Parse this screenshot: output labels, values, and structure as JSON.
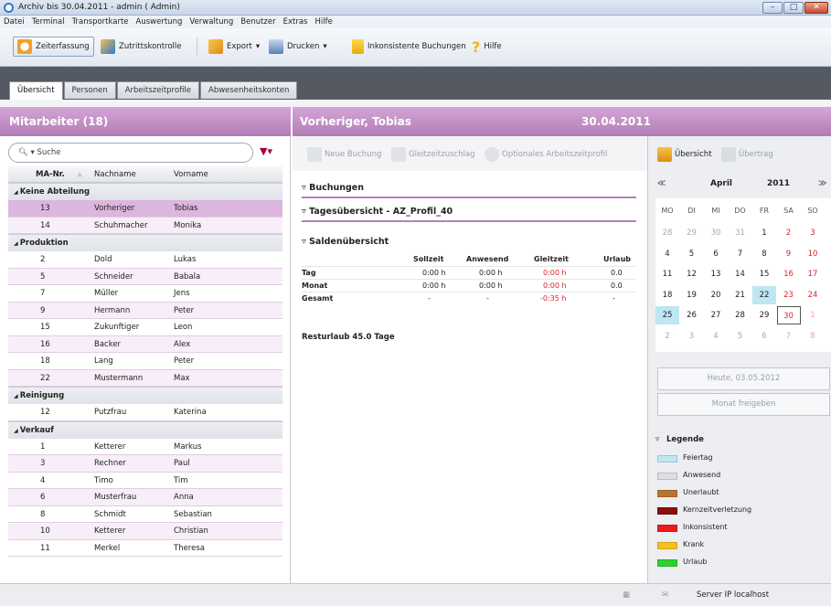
{
  "window": {
    "title": "Archiv bis 30.04.2011 - admin ( Admin)"
  },
  "menu": [
    "Datei",
    "Terminal",
    "Transportkarte",
    "Auswertung",
    "Verwaltung",
    "Benutzer",
    "Extras",
    "Hilfe"
  ],
  "toolbar": {
    "zeiterfassung": "Zeiterfassung",
    "zutrittskontrolle": "Zutrittskontrolle",
    "export": "Export",
    "drucken": "Drucken",
    "inkonsistente": "Inkonsistente Buchungen",
    "hilfe": "Hilfe"
  },
  "tabs": [
    "Übersicht",
    "Personen",
    "Arbeitszeitprofile",
    "Abwesenheitskonten"
  ],
  "left": {
    "header": "Mitarbeiter (18)",
    "search_placeholder": "Suche",
    "col_nr": "MA-Nr.",
    "col_nachname": "Nachname",
    "col_vorname": "Vorname",
    "groups": [
      {
        "name": "Keine Abteilung",
        "rows": [
          [
            "13",
            "Vorheriger",
            "Tobias"
          ],
          [
            "14",
            "Schuhmacher",
            "Monika"
          ]
        ]
      },
      {
        "name": "Produktion",
        "rows": [
          [
            "2",
            "Dold",
            "Lukas"
          ],
          [
            "5",
            "Schneider",
            "Babala"
          ],
          [
            "7",
            "Müller",
            "Jens"
          ],
          [
            "9",
            "Hermann",
            "Peter"
          ],
          [
            "15",
            "Zukunftiger",
            "Leon"
          ],
          [
            "16",
            "Backer",
            "Alex"
          ],
          [
            "18",
            "Lang",
            "Peter"
          ],
          [
            "22",
            "Mustermann",
            "Max"
          ]
        ]
      },
      {
        "name": "Reinigung",
        "rows": [
          [
            "12",
            "Putzfrau",
            "Katerina"
          ]
        ]
      },
      {
        "name": "Verkauf",
        "rows": [
          [
            "1",
            "Ketterer",
            "Markus"
          ],
          [
            "3",
            "Rechner",
            "Paul"
          ],
          [
            "4",
            "Timo",
            "Tim"
          ],
          [
            "6",
            "Musterfrau",
            "Anna"
          ],
          [
            "8",
            "Schmidt",
            "Sebastian"
          ],
          [
            "10",
            "Ketterer",
            "Christian"
          ],
          [
            "11",
            "Merkel",
            "Theresa"
          ]
        ]
      }
    ]
  },
  "center": {
    "header_name": "Vorheriger, Tobias",
    "header_date": "30.04.2011",
    "actions": [
      "Neue Buchung",
      "Gleitzeitzuschlag",
      "Optionales Arbeitszeitprofil"
    ],
    "sec_buchungen": "Buchungen",
    "sec_tages": "Tagesübersicht - AZ_Profil_40",
    "sec_salden": "Saldenübersicht",
    "saldo_cols": [
      "Sollzeit",
      "Anwesend",
      "Gleitzeit",
      "Urlaub"
    ],
    "saldo_rows": [
      {
        "label": "Tag",
        "values": [
          "0:00 h",
          "0:00 h",
          "0:00 h",
          "0.0"
        ]
      },
      {
        "label": "Monat",
        "values": [
          "0:00 h",
          "0:00 h",
          "0:00 h",
          "0.0"
        ]
      },
      {
        "label": "Gesamt",
        "values": [
          "-",
          "-",
          "-0:35 h",
          "-"
        ]
      }
    ],
    "resturlaub": "Resturlaub 45.0 Tage"
  },
  "right": {
    "uebersicht": "Übersicht",
    "uebertrag": "Übertrag",
    "month": "April",
    "year": "2011",
    "weekdays": [
      "MO",
      "DI",
      "MI",
      "DO",
      "FR",
      "SA",
      "SO"
    ],
    "days": [
      [
        "28",
        "29",
        "30",
        "31",
        "1",
        "2",
        "3"
      ],
      [
        "4",
        "5",
        "6",
        "7",
        "8",
        "9",
        "10"
      ],
      [
        "11",
        "12",
        "13",
        "14",
        "15",
        "16",
        "17"
      ],
      [
        "18",
        "19",
        "20",
        "21",
        "22",
        "23",
        "24"
      ],
      [
        "25",
        "26",
        "27",
        "28",
        "29",
        "30",
        "1"
      ],
      [
        "2",
        "3",
        "4",
        "5",
        "6",
        "7",
        "8"
      ]
    ],
    "heute": "Heute, 03.05.2012",
    "freigeben": "Monat freigeben",
    "legend_title": "Legende",
    "legend": [
      {
        "label": "Feiertag",
        "color": "#bfe6f3"
      },
      {
        "label": "Anwesend",
        "color": "#dedfe2"
      },
      {
        "label": "Unerlaubt",
        "color": "#b8762c"
      },
      {
        "label": "Kernzeitverletzung",
        "color": "#8b0f0f"
      },
      {
        "label": "Inkonsistent",
        "color": "#ef1b1b"
      },
      {
        "label": "Krank",
        "color": "#f4c21a"
      },
      {
        "label": "Urlaub",
        "color": "#2ed02e"
      }
    ]
  },
  "status": {
    "server": "Server IP localhost"
  }
}
